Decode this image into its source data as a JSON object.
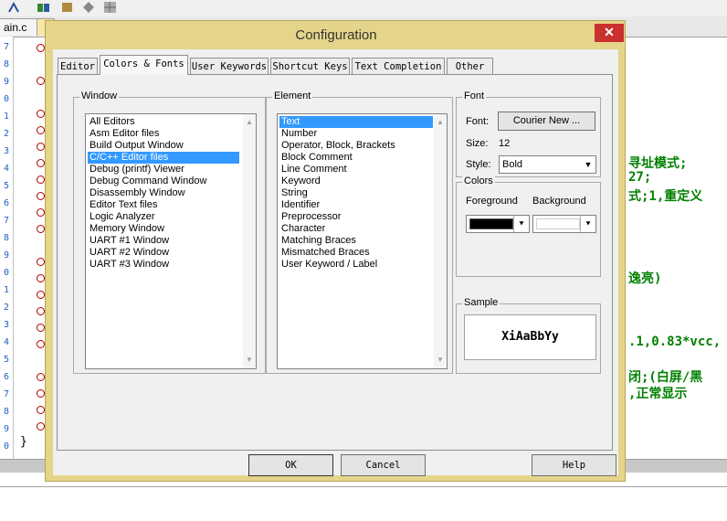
{
  "editor": {
    "tabs": [
      "ain.c"
    ],
    "code_lines": [
      "寻址模式;",
      "27;",
      "式;1,重定义",
      "逸亮)",
      ".1,0.83*vcc,",
      "闭;(白屏/黑",
      ",正常显示"
    ],
    "closing_brace": "}",
    "gutter_numbers": [
      "7",
      "8",
      "9",
      "0",
      "1",
      "2",
      "3",
      "4",
      "5",
      "6",
      "7",
      "8",
      "9",
      "0",
      "1",
      "2",
      "3",
      "4",
      "5",
      "6",
      "7",
      "8",
      "9",
      "0"
    ]
  },
  "dialog": {
    "title": "Configuration",
    "close_label": "✕",
    "tabs": [
      {
        "label": "Editor"
      },
      {
        "label": "Colors & Fonts"
      },
      {
        "label": "User Keywords"
      },
      {
        "label": "Shortcut Keys"
      },
      {
        "label": "Text Completion"
      },
      {
        "label": "Other"
      }
    ],
    "window_group": {
      "label": "Window",
      "items": [
        "All Editors",
        "Asm Editor files",
        "Build Output Window",
        "C/C++ Editor files",
        "Debug (printf) Viewer",
        "Debug Command Window",
        "Disassembly Window",
        "Editor Text files",
        "Logic Analyzer",
        "Memory Window",
        "UART #1 Window",
        "UART #2 Window",
        "UART #3 Window"
      ],
      "selected": "C/C++ Editor files"
    },
    "element_group": {
      "label": "Element",
      "items": [
        "Text",
        "Number",
        "Operator, Block, Brackets",
        "Block Comment",
        "Line Comment",
        "Keyword",
        "String",
        "Identifier",
        "Preprocessor",
        "Character",
        "Matching Braces",
        "Mismatched Braces",
        "User Keyword / Label"
      ],
      "selected": "Text"
    },
    "font_group": {
      "label": "Font",
      "font_label": "Font:",
      "font_button": "Courier New ...",
      "size_label": "Size:",
      "size_value": "12",
      "style_label": "Style:",
      "style_value": "Bold"
    },
    "colors_group": {
      "label": "Colors",
      "foreground_label": "Foreground",
      "background_label": "Background",
      "foreground_color": "#000000",
      "background_color": "#ffffff"
    },
    "sample_group": {
      "label": "Sample",
      "text": "XiAaBbYy"
    },
    "buttons": {
      "ok": "OK",
      "cancel": "Cancel",
      "help": "Help"
    }
  },
  "colors": {
    "title_bar": "#e5d58a",
    "close_button": "#c8312d",
    "selection": "#3399ff",
    "code_text": "#008000"
  }
}
